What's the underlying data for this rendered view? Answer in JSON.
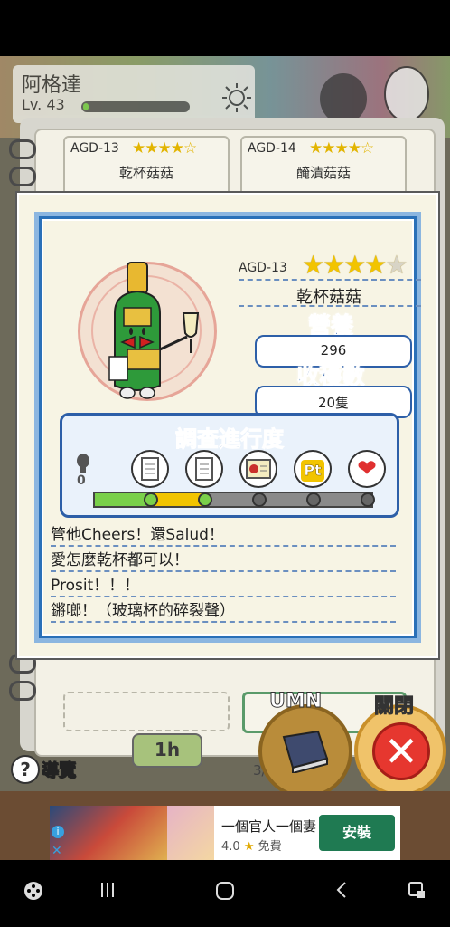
{
  "profile": {
    "name": "阿格達",
    "level": "Lv. 43",
    "exp_fraction": 0.05
  },
  "bg_cards": [
    {
      "code": "AGD-13",
      "stars": "★★★★☆",
      "name": "乾杯菇菇"
    },
    {
      "code": "AGD-14",
      "stars": "★★★★☆",
      "name": "醃漬菇菇"
    }
  ],
  "pager": "3/3",
  "buttons": {
    "guide": "導覽",
    "umn": "UMN",
    "close": "關閉",
    "close_symbol": "✕",
    "time": "1h"
  },
  "detail": {
    "code": "AGD-13",
    "stars": {
      "filled": "★★★★",
      "empty": "★"
    },
    "name": "乾杯菇菇",
    "nutrition_label": "營養",
    "nutrition_value": "296",
    "harvest_label": "收穫數",
    "harvest_value": "20隻",
    "progress_title": "調查進行度",
    "progress_zero": "0",
    "description_lines": [
      "管他Cheers！還Salud！",
      "愛怎麼乾杯都可以！",
      "Prosit！！！",
      "鏘啷！（玻璃杯的碎裂聲）"
    ]
  },
  "ad": {
    "title": "一個官人一個妻",
    "rating": "4.0",
    "price": "免費",
    "install": "安裝"
  },
  "colors": {
    "accent_blue": "#2d5fa8",
    "close_red": "#e6372f",
    "star_gold": "#f2c400"
  }
}
